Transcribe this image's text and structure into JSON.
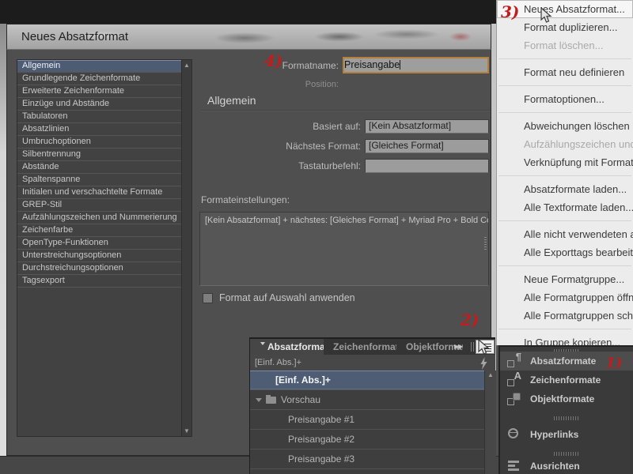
{
  "dialog": {
    "title": "Neues Absatzformat",
    "sidebar": {
      "selected": "Allgemein",
      "items": [
        "Allgemein",
        "Grundlegende Zeichenformate",
        "Erweiterte Zeichenformate",
        "Einzüge und Abstände",
        "Tabulatoren",
        "Absatzlinien",
        "Umbruchoptionen",
        "Silbentrennung",
        "Abstände",
        "Spaltenspanne",
        "Initialen und verschachtelte Formate",
        "GREP-Stil",
        "Aufzählungszeichen und Nummerierung",
        "Zeichenfarbe",
        "OpenType-Funktionen",
        "Unterstreichungsoptionen",
        "Durchstreichungsoptionen",
        "Tagsexport"
      ]
    },
    "form": {
      "format_name_label": "Formatname:",
      "format_name_value": "Preisangabe",
      "position_label": "Position:",
      "section_heading": "Allgemein",
      "based_on_label": "Basiert auf:",
      "based_on_value": "[Kein Absatzformat]",
      "next_format_label": "Nächstes Format:",
      "next_format_value": "[Gleiches Format]",
      "shortcut_label": "Tastaturbefehl:",
      "shortcut_value": "",
      "settings_label": "Formateinstellungen:",
      "settings_text": "[Kein Absatzformat] + nächstes: [Gleiches Format] + Myriad Pro + Bold Condensed + Grö",
      "apply_label": "Format auf Auswahl anwenden",
      "apply_checked": false
    }
  },
  "styles_panel": {
    "tabs": [
      {
        "label": "Absatzformate",
        "active": true
      },
      {
        "label": "Zeichenformate",
        "active": false
      },
      {
        "label": "Objektformate",
        "active": false
      }
    ],
    "overflow_icon": "»»",
    "status_text": "[Einf. Abs.]+",
    "rows": [
      {
        "label": "[Einf. Abs.]+",
        "type": "style",
        "selected": true
      },
      {
        "label": "Vorschau",
        "type": "folder",
        "expanded": true
      },
      {
        "label": "Preisangabe #1",
        "type": "style",
        "selected": false
      },
      {
        "label": "Preisangabe #2",
        "type": "style",
        "selected": false
      },
      {
        "label": "Preisangabe #3",
        "type": "style",
        "selected": false
      }
    ]
  },
  "context_menu": {
    "items": [
      {
        "label": "Neues Absatzformat...",
        "state": "highlighted"
      },
      {
        "label": "Format duplizieren...",
        "state": "normal"
      },
      {
        "label": "Format löschen...",
        "state": "disabled"
      },
      {
        "label": "Format neu definieren",
        "state": "normal"
      },
      {
        "label": "Formatoptionen...",
        "state": "normal"
      },
      {
        "label": "Abweichungen löschen",
        "state": "normal"
      },
      {
        "label": "Aufzählungszeichen und Nummerierung in Text umwandeln",
        "state": "disabled"
      },
      {
        "label": "Verknüpfung mit Format aufheben",
        "state": "normal"
      },
      {
        "label": "Absatzformate laden...",
        "state": "normal"
      },
      {
        "label": "Alle Textformate laden...",
        "state": "normal"
      },
      {
        "label": "Alle nicht verwendeten auswählen",
        "state": "normal"
      },
      {
        "label": "Alle Exporttags bearbeiten...",
        "state": "normal"
      },
      {
        "label": "Neue Formatgruppe...",
        "state": "normal"
      },
      {
        "label": "Alle Formatgruppen öffnen",
        "state": "normal"
      },
      {
        "label": "Alle Formatgruppen schließen",
        "state": "normal"
      },
      {
        "label": "In Gruppe kopieren...",
        "state": "normal"
      }
    ]
  },
  "dock": {
    "items": [
      {
        "label": "Absatzformate",
        "icon": "paragraph-styles-icon",
        "highlighted": true
      },
      {
        "label": "Zeichenformate",
        "icon": "character-styles-icon",
        "highlighted": false
      },
      {
        "label": "Objektformate",
        "icon": "object-styles-icon",
        "highlighted": false
      },
      {
        "label": "Hyperlinks",
        "icon": "hyperlinks-icon",
        "highlighted": false
      },
      {
        "label": "Ausrichten",
        "icon": "align-icon",
        "highlighted": false
      }
    ]
  },
  "annotations": {
    "one": "1)",
    "two": "2)",
    "three": "3)",
    "four": "4)"
  },
  "colors": {
    "annotation_red": "#c21c1c",
    "selection_blue": "#4e5c74",
    "focus_orange": "#b5803c",
    "dialog_gray": "#4f4f4f"
  }
}
